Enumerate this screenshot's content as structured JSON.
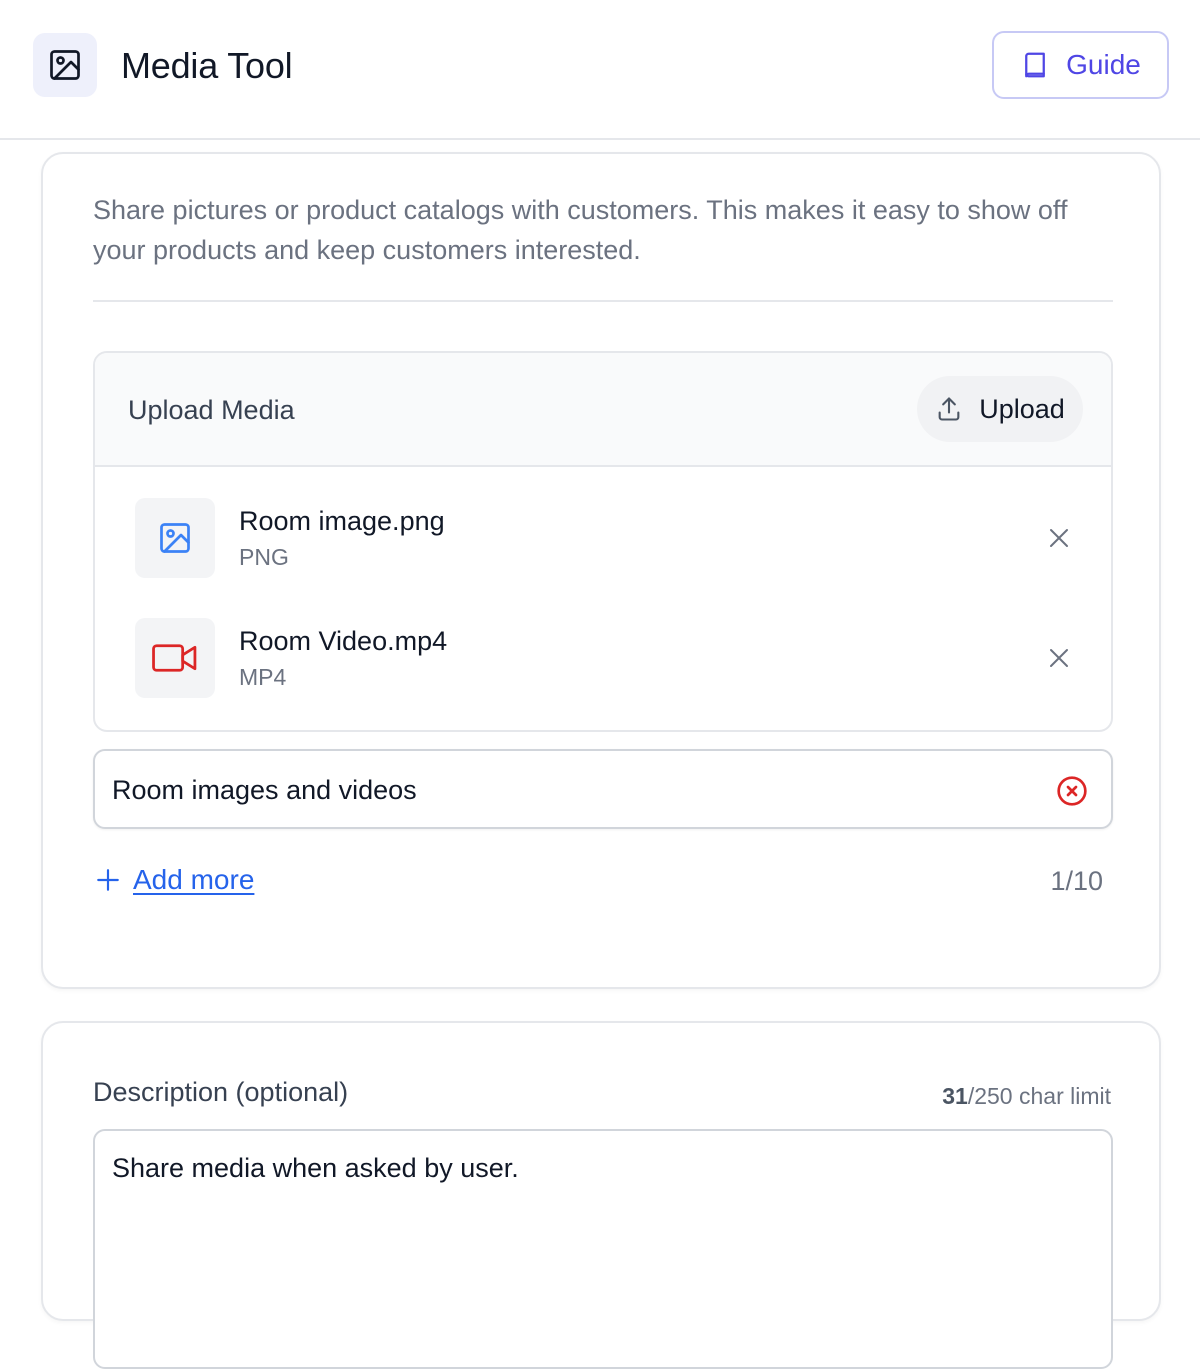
{
  "header": {
    "title": "Media Tool",
    "guide_label": "Guide"
  },
  "media_card": {
    "intro": "Share pictures or product catalogs with customers. This makes it easy to show off your products and keep customers interested.",
    "upload": {
      "title": "Upload Media",
      "button_label": "Upload"
    },
    "files": [
      {
        "name": "Room image.png",
        "type": "PNG",
        "icon": "image-icon",
        "icon_color": "#3b82f6"
      },
      {
        "name": "Room Video.mp4",
        "type": "MP4",
        "icon": "video-icon",
        "icon_color": "#dc2626"
      }
    ],
    "title_input_value": "Room images and videos",
    "add_more_label": "Add more",
    "count": "1/10"
  },
  "description": {
    "label": "Description (optional)",
    "char_count": "31",
    "char_limit_suffix": "/250 char limit",
    "value": "Share media when asked by user."
  },
  "colors": {
    "accent": "#4f46e5",
    "link": "#2563eb",
    "danger": "#dc2626"
  }
}
